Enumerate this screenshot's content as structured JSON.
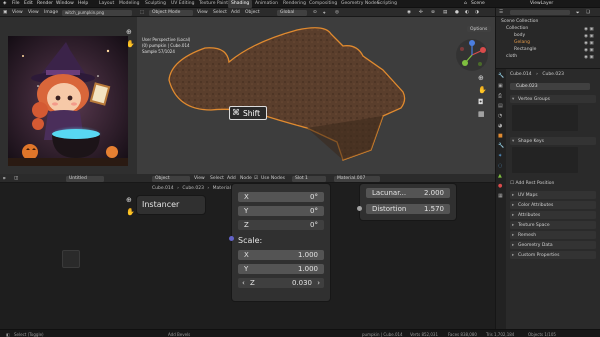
{
  "menubar": {
    "menus": [
      "File",
      "Edit",
      "Render",
      "Window",
      "Help"
    ],
    "window_title": "C:\\Users\\...\\Blender 4.1\\Project\\witch_scene.blend",
    "workspaces": [
      "Layout",
      "Modeling",
      "Sculpting",
      "UV Editing",
      "Texture Paint",
      "Shading",
      "Animation",
      "Rendering",
      "Compositing",
      "Geometry Nodes",
      "Scripting"
    ],
    "active_workspace": "Shading",
    "scene": "Scene",
    "view_layer": "ViewLayer"
  },
  "image_editor": {
    "header": [
      "View",
      "View",
      "Image"
    ],
    "image_name": "witch_pumpkin.png"
  },
  "viewport": {
    "mode": "Object Mode",
    "menus": [
      "View",
      "Select",
      "Add",
      "Object"
    ],
    "orientation": "Global",
    "options": "Options",
    "info_line1": "User Perspective (Local)",
    "info_line2": "(0) pumpkin | Cube.014",
    "info_line3": "Sample 57/1024",
    "shift_key": "Shift"
  },
  "node_editor": {
    "header": {
      "editor": "Untitled",
      "object_mode": "Object",
      "menus": [
        "View",
        "Select",
        "Add",
        "Node"
      ],
      "use_nodes": "Use Nodes",
      "slot": "Slot 1",
      "material": "Material.007"
    },
    "breadcrumb": [
      "Cube.014",
      "Cube.023",
      "Material.007"
    ],
    "instancer_label": "Instancer",
    "mapping": {
      "rot_x_label": "X",
      "rot_x": "0°",
      "rot_y_label": "Y",
      "rot_y": "0°",
      "rot_z_label": "Z",
      "rot_z": "0°",
      "scale_label": "Scale:",
      "scale_x_label": "X",
      "scale_x": "1.000",
      "scale_y_label": "Y",
      "scale_y": "1.000",
      "scale_z_label": "Z",
      "scale_z": "0.030"
    },
    "noise": {
      "lacunarity_label": "Lacunar...",
      "lacunarity": "2.000",
      "distortion_label": "Distortion",
      "distortion": "1.570"
    }
  },
  "outliner": {
    "title": "Scene Collection",
    "rows": [
      "Collection",
      "body",
      "Gelang",
      "Rectangle",
      "cloth"
    ]
  },
  "properties": {
    "object": "Cube.014",
    "mesh": "Cube.023",
    "data_name": "Cube.023",
    "panels": [
      "Vertex Groups",
      "Shape Keys",
      "Add Rest Position",
      "UV Maps",
      "Color Attributes",
      "Attributes",
      "Texture Space",
      "Remesh",
      "Geometry Data",
      "Custom Properties"
    ]
  },
  "statusbar": {
    "left": "Select (Toggle)",
    "middle": "Add Bevels",
    "right1": "pumpkin | Cube.014",
    "right2": "Verts 852,031",
    "right3": "Faces 838,080",
    "right4": "Tris 1,702,184",
    "right5": "Objects 1/105"
  },
  "colors": {
    "active_tab": "#3a3a3a",
    "selection_outline": "#e08a2f",
    "vector_socket": "#6363c7",
    "float_socket": "#a1a1a1"
  }
}
